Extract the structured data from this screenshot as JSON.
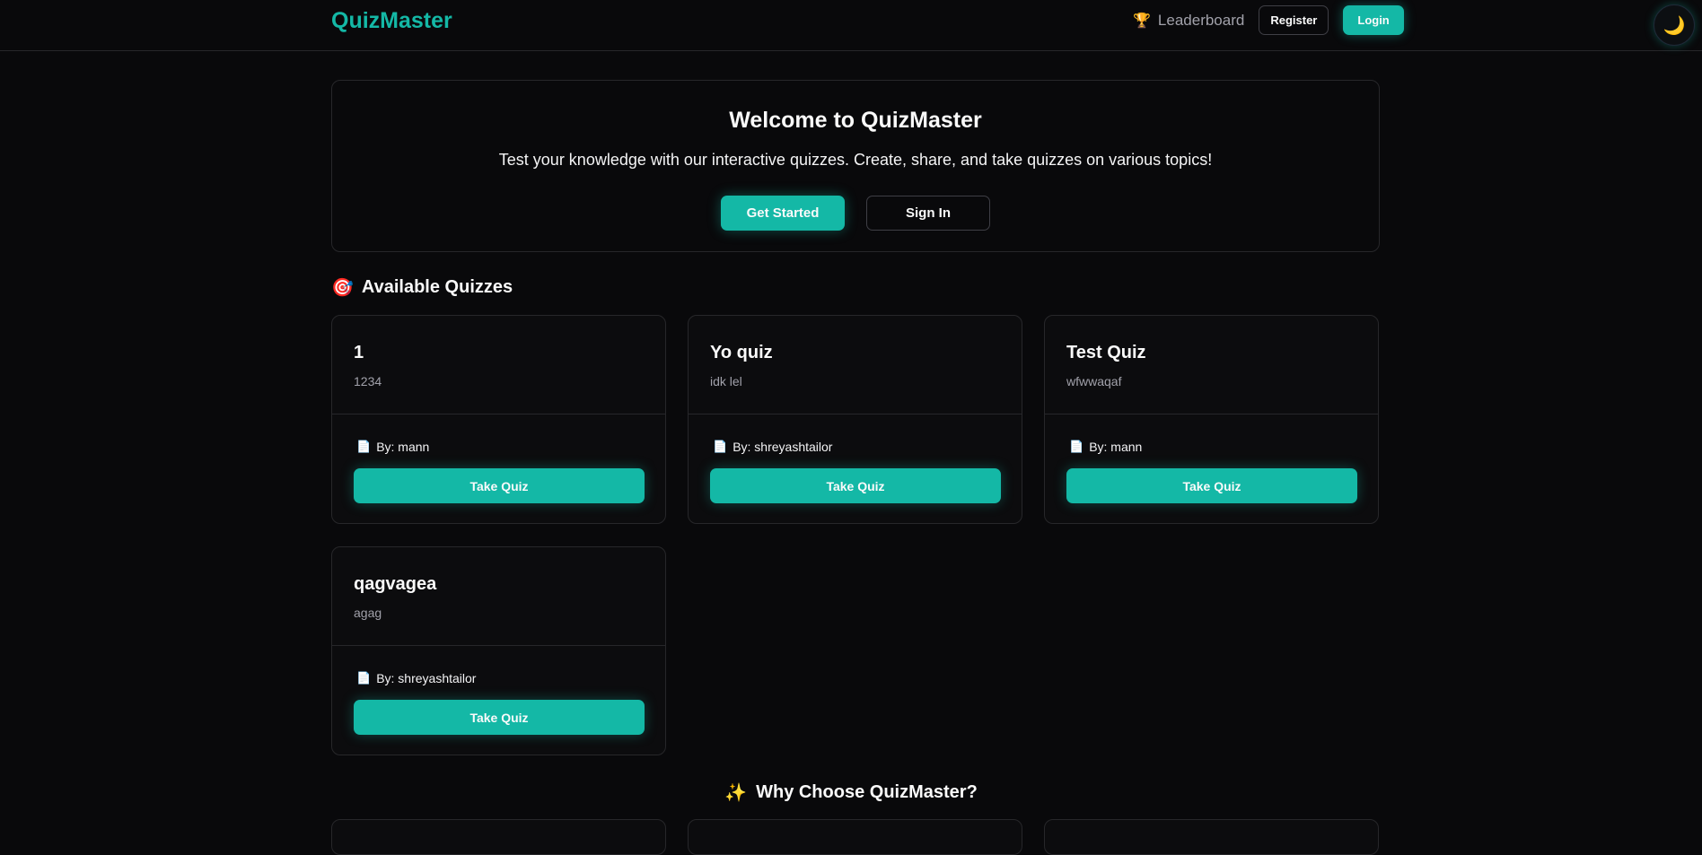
{
  "navbar": {
    "brand": "QuizMaster",
    "leaderboard_icon": "trophy-icon",
    "leaderboard_glyph": "🏆",
    "leaderboard_label": "Leaderboard",
    "register_label": "Register",
    "login_label": "Login",
    "theme_icon": "moon-icon",
    "theme_glyph": "🌙"
  },
  "hero": {
    "title": "Welcome to QuizMaster",
    "subtitle": "Test your knowledge with our interactive quizzes. Create, share, and take quizzes on various topics!",
    "get_started_label": "Get Started",
    "sign_in_label": "Sign In"
  },
  "quizzes_section": {
    "icon": "target-icon",
    "glyph": "🎯",
    "title": "Available Quizzes",
    "author_icon": "document-icon",
    "author_glyph": "📄",
    "items": [
      {
        "title": "1",
        "description": "1234",
        "author": "By: mann",
        "button": "Take Quiz"
      },
      {
        "title": "Yo quiz",
        "description": "idk lel",
        "author": "By: shreyashtailor",
        "button": "Take Quiz"
      },
      {
        "title": "Test Quiz",
        "description": "wfwwaqaf",
        "author": "By: mann",
        "button": "Take Quiz"
      },
      {
        "title": "qagvagea",
        "description": "agag",
        "author": "By: shreyashtailor",
        "button": "Take Quiz"
      }
    ]
  },
  "why_section": {
    "icon": "sparkles-icon",
    "glyph": "✨",
    "title": "Why Choose QuizMaster?"
  },
  "colors": {
    "background": "#09090b",
    "accent": "#14b8a6",
    "border": "#27272a",
    "muted_text": "#a1a1aa"
  }
}
